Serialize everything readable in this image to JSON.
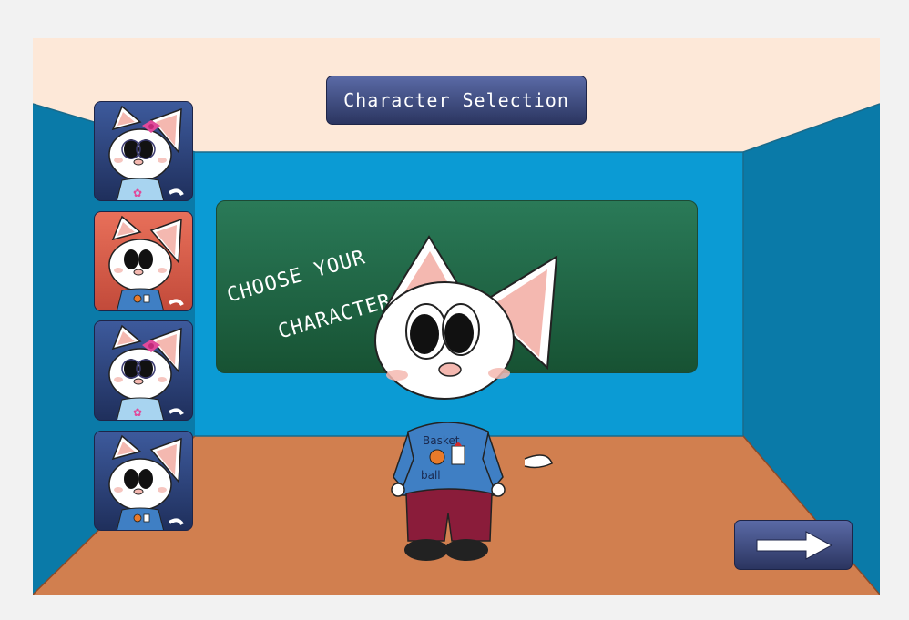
{
  "title": {
    "text": "Character Selection"
  },
  "chalkboard": {
    "line1": "CHOOSE YOUR",
    "line2": "CHARACTER"
  },
  "characters": [
    {
      "name": "girl-bow-blue",
      "bg_top": "#3d5a9c",
      "bg_bottom": "#1f2f5c",
      "has_bow": true,
      "shirt": "#a8d4f0"
    },
    {
      "name": "boy-basketball-red",
      "bg_top": "#e8705a",
      "bg_bottom": "#c24a3a",
      "has_bow": false,
      "shirt": "#3f7fc4"
    },
    {
      "name": "girl-bow-blue-2",
      "bg_top": "#3d5a9c",
      "bg_bottom": "#1f2f5c",
      "has_bow": true,
      "shirt": "#a8d4f0"
    },
    {
      "name": "boy-basketball-blue",
      "bg_top": "#3d5a9c",
      "bg_bottom": "#1f2f5c",
      "has_bow": false,
      "shirt": "#3f7fc4"
    }
  ],
  "shirt_text": {
    "line1": "Basket",
    "line2": "ball"
  },
  "next_button": {
    "icon": "right-arrow-icon"
  },
  "colors": {
    "ceiling": "#fde8d8",
    "back_wall": "#0b9bd4",
    "side_wall": "#0a7aa8",
    "floor": "#d17f4f",
    "banner": "#2f3a6b",
    "ear": "#f4b8b0",
    "pants": "#8a1c3a"
  }
}
